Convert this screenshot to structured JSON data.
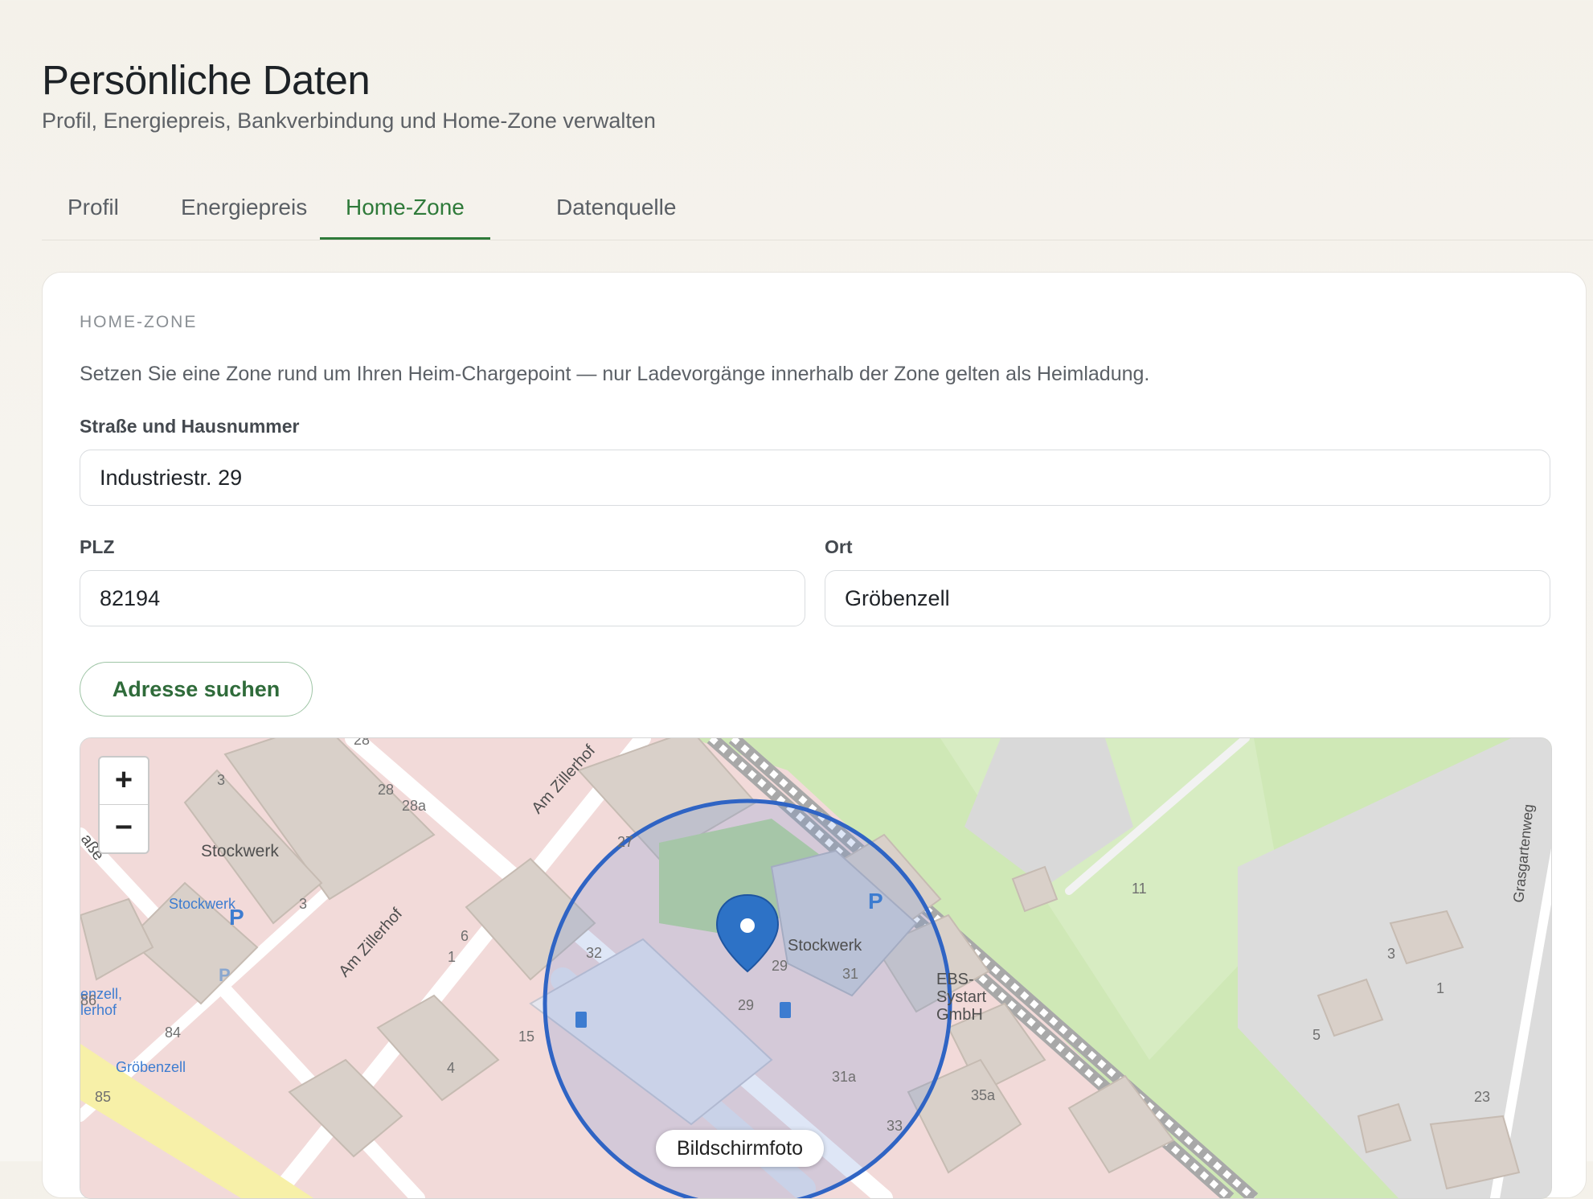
{
  "page": {
    "title": "Persönliche Daten",
    "subtitle": "Profil, Energiepreis, Bankverbindung und Home-Zone verwalten"
  },
  "tabs": [
    {
      "label": "Profil",
      "active": false
    },
    {
      "label": "Energiepreis",
      "active": false
    },
    {
      "label": "Home-Zone",
      "active": true
    },
    {
      "label": "Datenquelle",
      "active": false
    }
  ],
  "home_zone": {
    "section_label": "HOME-ZONE",
    "description": "Setzen Sie eine Zone rund um Ihren Heim-Chargepoint — nur Ladevorgänge innerhalb der Zone gelten als Heimladung.",
    "street_label": "Straße und Hausnummer",
    "street_value": "Industriestr. 29",
    "plz_label": "PLZ",
    "plz_value": "82194",
    "ort_label": "Ort",
    "ort_value": "Gröbenzell",
    "search_button": "Adresse suchen"
  },
  "map": {
    "zoom_in": "+",
    "zoom_out": "−",
    "tooltip": "Bildschirmfoto",
    "labels": {
      "stockwerk_top": "Stockwerk",
      "stockwerk_poi": "Stockwerk",
      "stockwerk_center": "Stockwerk",
      "am_zillerhof_1": "Am Zillerhof",
      "am_zillerhof_2": "Am Zillerhof",
      "grasgartenweg": "Grasgartenweg",
      "ebs_1": "EBS-",
      "ebs_2": "Systart",
      "ebs_3": "GmbH",
      "strasse": "aße",
      "groebenzell_1": "enzell,",
      "groebenzell_2": "lerhof",
      "groebenzell_3": "Gröbenzell"
    },
    "house_numbers": {
      "n28top": "28",
      "n28": "28",
      "n28a": "28a",
      "n3a": "3",
      "n3b": "3",
      "n27": "27",
      "n6": "6",
      "n1a": "1",
      "n32": "32",
      "n29a": "29",
      "n29b": "29",
      "n31": "31",
      "n15": "15",
      "n4": "4",
      "n31a": "31a",
      "n35a": "35a",
      "n33": "33",
      "n86": "86",
      "n84": "84",
      "n85": "85",
      "n11": "11",
      "n3c": "3",
      "n1b": "1",
      "n5": "5",
      "n23": "23"
    },
    "parking_symbol": "P",
    "colors": {
      "residential": "#f2dad9",
      "building": "#d9d0c9",
      "park": "#cdebb0",
      "zone_stroke": "#2f64c4",
      "zone_fill": "#6a8fd8"
    }
  }
}
